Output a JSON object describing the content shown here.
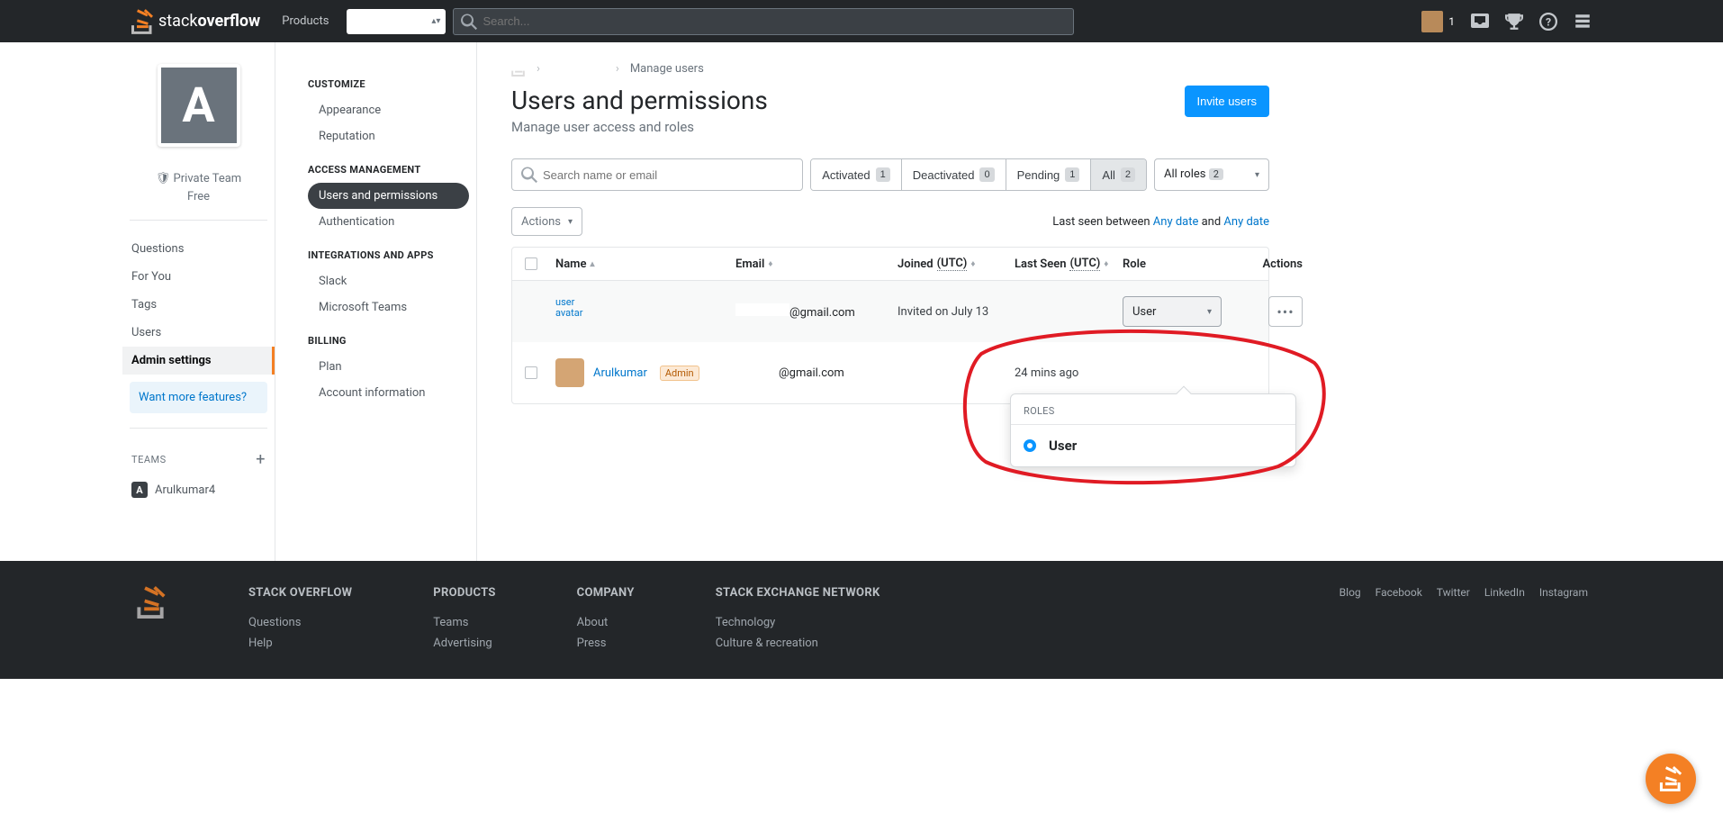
{
  "topbar": {
    "logo_stack": "stack",
    "logo_overflow": "overflow",
    "products": "Products",
    "search_placeholder": "Search...",
    "rep": "1"
  },
  "left_sidebar": {
    "team_letter": "A",
    "private_team": "Private Team",
    "free": "Free",
    "nav": [
      "Questions",
      "For You",
      "Tags",
      "Users",
      "Admin settings"
    ],
    "active_nav": "Admin settings",
    "want_more": "Want more features?",
    "teams_header": "TEAMS",
    "team_name": "Arulkumar4",
    "team_letter_small": "A"
  },
  "settings_menu": {
    "sections": [
      {
        "header": "CUSTOMIZE",
        "items": [
          "Appearance",
          "Reputation"
        ]
      },
      {
        "header": "ACCESS MANAGEMENT",
        "items": [
          "Users and permissions",
          "Authentication"
        ]
      },
      {
        "header": "INTEGRATIONS AND APPS",
        "items": [
          "Slack",
          "Microsoft Teams"
        ]
      },
      {
        "header": "BILLING",
        "items": [
          "Plan",
          "Account information"
        ]
      }
    ],
    "active_item": "Users and permissions"
  },
  "breadcrumbs": {
    "manage_users": "Manage users"
  },
  "page": {
    "title": "Users and permissions",
    "subtitle": "Manage user access and roles",
    "invite": "Invite users"
  },
  "filters": {
    "search_placeholder": "Search name or email",
    "activated": "Activated",
    "activated_n": "1",
    "deactivated": "Deactivated",
    "deactivated_n": "0",
    "pending": "Pending",
    "pending_n": "1",
    "all": "All",
    "all_n": "2",
    "all_roles": "All roles",
    "all_roles_n": "2"
  },
  "actions_row": {
    "actions": "Actions",
    "seen_prefix": "Last seen between ",
    "any_date": "Any date",
    "and": " and "
  },
  "thead": {
    "name": "Name",
    "email": "Email",
    "joined": "Joined ",
    "joined_utc": "(UTC)",
    "last_seen": "Last Seen ",
    "last_seen_utc": "(UTC)",
    "role": "Role",
    "actions": "Actions"
  },
  "rows": [
    {
      "avatar_alt": "user avatar",
      "name": "",
      "admin": false,
      "email_suffix": "@gmail.com",
      "joined": "Invited on July 13",
      "last_seen": "",
      "role": "User"
    },
    {
      "avatar_alt": "",
      "name": "Arulkumar",
      "admin": true,
      "admin_label": "Admin",
      "email_suffix": "@gmail.com",
      "joined": "",
      "last_seen": "24 mins ago",
      "role": ""
    }
  ],
  "popover": {
    "header": "ROLES",
    "option": "User"
  },
  "footer": {
    "cols": [
      {
        "header": "STACK OVERFLOW",
        "links": [
          "Questions",
          "Help"
        ]
      },
      {
        "header": "PRODUCTS",
        "links": [
          "Teams",
          "Advertising"
        ]
      },
      {
        "header": "COMPANY",
        "links": [
          "About",
          "Press"
        ]
      },
      {
        "header": "STACK EXCHANGE NETWORK",
        "links": [
          "Technology",
          "Culture & recreation"
        ]
      }
    ],
    "social": [
      "Blog",
      "Facebook",
      "Twitter",
      "LinkedIn",
      "Instagram"
    ]
  }
}
